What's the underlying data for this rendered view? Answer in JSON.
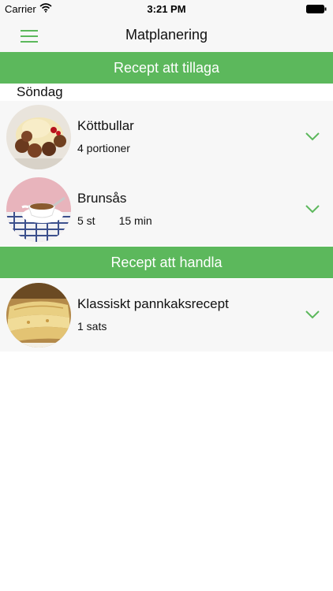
{
  "status_bar": {
    "carrier": "Carrier",
    "time": "3:21 PM"
  },
  "nav": {
    "title": "Matplanering",
    "menu_icon": "hamburger-menu-icon"
  },
  "colors": {
    "accent": "#5cb85c",
    "row_bg": "#f7f7f7"
  },
  "sections": [
    {
      "title": "Recept att tillaga",
      "day": "Söndag",
      "recipes": [
        {
          "name": "Köttbullar",
          "servings": "4 portioner",
          "time": ""
        },
        {
          "name": "Brunsås",
          "servings": "5 st",
          "time": "15 min"
        }
      ]
    },
    {
      "title": "Recept att handla",
      "recipes": [
        {
          "name": "Klassiskt pannkaksrecept",
          "servings": "1 sats",
          "time": ""
        }
      ]
    }
  ]
}
